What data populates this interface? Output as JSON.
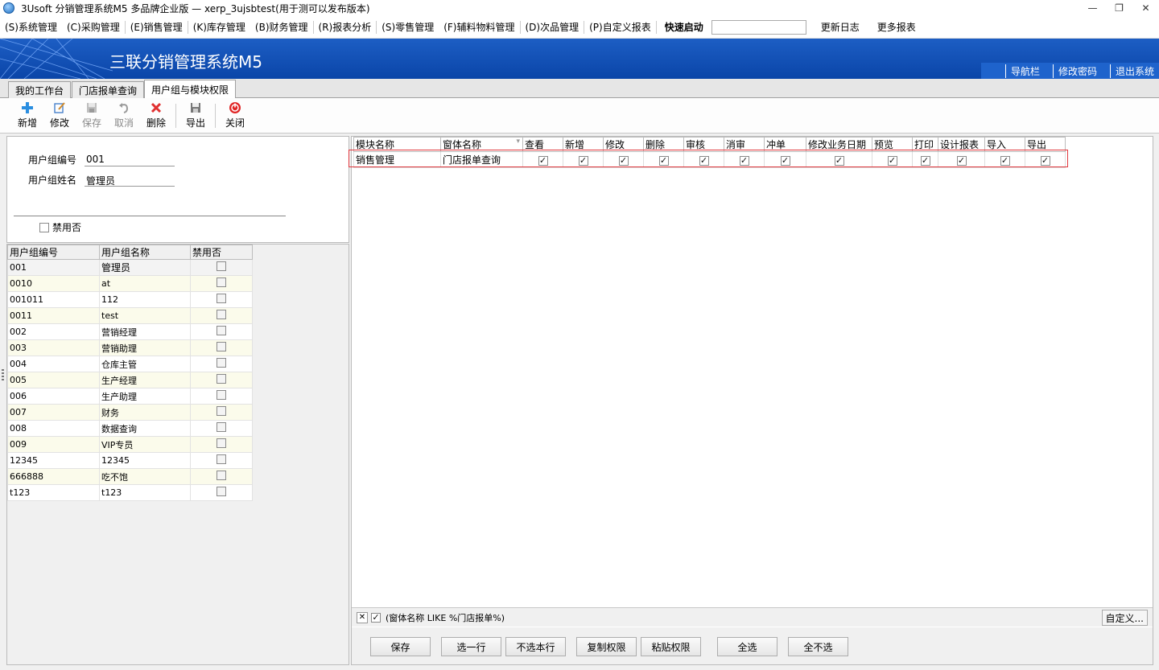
{
  "window": {
    "title": "3Usoft 分销管理系统M5 多品牌企业版 — xerp_3ujsbtest(用于测可以发布版本)",
    "minimize": "—",
    "restore": "❐",
    "close": "✕"
  },
  "menu": {
    "items": [
      "(S)系统管理",
      "(C)采购管理",
      "(E)销售管理",
      "(K)库存管理",
      "(B)财务管理",
      "(R)报表分析",
      "(S)零售管理",
      "(F)辅料物料管理",
      "(D)次品管理",
      "(P)自定义报表"
    ],
    "quick_launch_label": "快速启动",
    "quick_launch_value": "",
    "update_log": "更新日志",
    "more_reports": "更多报表"
  },
  "banner": {
    "brand": "三联分销管理系统M5",
    "nav": "导航栏",
    "change_password": "修改密码",
    "logout": "退出系统",
    "colors": {
      "bg": "#0a45a8"
    }
  },
  "tabs": [
    "我的工作台",
    "门店报单查询",
    "用户组与模块权限"
  ],
  "toolbar": {
    "add": "新增",
    "edit": "修改",
    "save": "保存",
    "cancel": "取消",
    "delete": "删除",
    "export": "导出",
    "close": "关闭"
  },
  "form": {
    "group_code_label": "用户组编号",
    "group_code_value": "001",
    "group_name_label": "用户组姓名",
    "group_name_value": "管理员",
    "disabled_label": "禁用否",
    "disabled_checked": false
  },
  "group_grid": {
    "headers": [
      "用户组编号",
      "用户组名称",
      "禁用否"
    ],
    "rows": [
      {
        "code": "001",
        "name": "管理员",
        "disabled": false
      },
      {
        "code": "0010",
        "name": "at",
        "disabled": false
      },
      {
        "code": "001011",
        "name": "112",
        "disabled": false
      },
      {
        "code": "0011",
        "name": "test",
        "disabled": false
      },
      {
        "code": "002",
        "name": "营销经理",
        "disabled": false
      },
      {
        "code": "003",
        "name": "营销助理",
        "disabled": false
      },
      {
        "code": "004",
        "name": "仓库主管",
        "disabled": false
      },
      {
        "code": "005",
        "name": "生产经理",
        "disabled": false
      },
      {
        "code": "006",
        "name": "生产助理",
        "disabled": false
      },
      {
        "code": "007",
        "name": "财务",
        "disabled": false
      },
      {
        "code": "008",
        "name": "数据查询",
        "disabled": false
      },
      {
        "code": "009",
        "name": "VIP专员",
        "disabled": false
      },
      {
        "code": "12345",
        "name": "12345",
        "disabled": false
      },
      {
        "code": "666888",
        "name": "吃不饱",
        "disabled": false
      },
      {
        "code": "t123",
        "name": "t123",
        "disabled": false
      }
    ]
  },
  "perm_grid": {
    "headers": [
      "模块名称",
      "窗体名称",
      "查看",
      "新增",
      "修改",
      "删除",
      "审核",
      "消审",
      "冲单",
      "修改业务日期",
      "预览",
      "打印",
      "设计报表",
      "导入",
      "导出"
    ],
    "rows": [
      {
        "module": "销售管理",
        "form": "门店报单查询",
        "flags": [
          true,
          true,
          true,
          true,
          true,
          true,
          true,
          true,
          true,
          true,
          true,
          true,
          true
        ]
      }
    ],
    "highlight_color": "#e0383e"
  },
  "filter": {
    "clear": "✕",
    "enabled": true,
    "text": "(窗体名称 LIKE %门店报单%)",
    "custom": "自定义..."
  },
  "actions": {
    "save": "保存",
    "select_row": "选一行",
    "unselect_row": "不选本行",
    "copy_perm": "复制权限",
    "paste_perm": "粘贴权限",
    "select_all": "全选",
    "select_none": "全不选"
  }
}
